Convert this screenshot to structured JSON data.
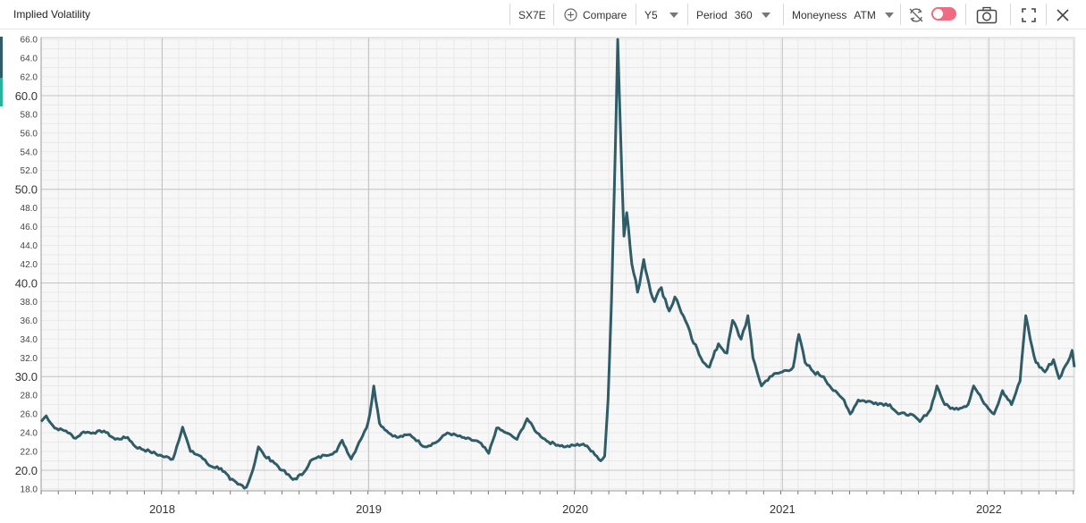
{
  "toolbar": {
    "title": "Implied Volatility",
    "ticker": "SX7E",
    "compare_label": "Compare",
    "tenor": "Y5",
    "period_label": "Period",
    "period_value": "360",
    "moneyness_label": "Moneyness",
    "moneyness_value": "ATM",
    "toggle_state": "off"
  },
  "colors": {
    "series": "#2f5c66",
    "toggle": "#f06a82",
    "accent_left": "#27b39a"
  },
  "chart_data": {
    "type": "line",
    "title": "",
    "xlabel": "",
    "ylabel": "",
    "ylim": [
      17.8,
      66.2
    ],
    "xlim": [
      "2017-06-01",
      "2022-06-01"
    ],
    "grid": true,
    "y_major_ticks": [
      "20.0",
      "30.0",
      "40.0",
      "50.0",
      "60.0"
    ],
    "y_minor_ticks": [
      "18.0",
      "22.0",
      "24.0",
      "26.0",
      "28.0",
      "32.0",
      "34.0",
      "36.0",
      "38.0",
      "42.0",
      "44.0",
      "46.0",
      "48.0",
      "52.0",
      "54.0",
      "56.0",
      "58.0",
      "62.0",
      "64.0",
      "66.0"
    ],
    "x_ticks": [
      "2018",
      "2019",
      "2020",
      "2021",
      "2022"
    ],
    "series": [
      {
        "color": "#2f5c66",
        "points": [
          [
            "2017-06-01",
            25.2
          ],
          [
            "2017-06-10",
            25.8
          ],
          [
            "2017-06-25",
            24.5
          ],
          [
            "2017-07-15",
            24.2
          ],
          [
            "2017-08-01",
            23.4
          ],
          [
            "2017-08-15",
            24.1
          ],
          [
            "2017-09-01",
            24.0
          ],
          [
            "2017-09-20",
            24.2
          ],
          [
            "2017-10-10",
            23.3
          ],
          [
            "2017-11-01",
            23.5
          ],
          [
            "2017-11-15",
            22.5
          ],
          [
            "2017-12-10",
            22.0
          ],
          [
            "2018-01-01",
            21.5
          ],
          [
            "2018-01-20",
            21.2
          ],
          [
            "2018-02-06",
            24.6
          ],
          [
            "2018-02-20",
            22.0
          ],
          [
            "2018-03-10",
            21.5
          ],
          [
            "2018-03-25",
            20.5
          ],
          [
            "2018-04-15",
            20.2
          ],
          [
            "2018-05-01",
            19.0
          ],
          [
            "2018-05-15",
            18.5
          ],
          [
            "2018-05-30",
            18.2
          ],
          [
            "2018-06-10",
            20.0
          ],
          [
            "2018-06-20",
            22.5
          ],
          [
            "2018-07-01",
            21.5
          ],
          [
            "2018-07-15",
            21.0
          ],
          [
            "2018-08-01",
            20.0
          ],
          [
            "2018-08-20",
            19.0
          ],
          [
            "2018-09-05",
            19.5
          ],
          [
            "2018-09-20",
            21.0
          ],
          [
            "2018-10-15",
            21.6
          ],
          [
            "2018-11-05",
            22.0
          ],
          [
            "2018-11-15",
            23.2
          ],
          [
            "2018-12-01",
            21.2
          ],
          [
            "2018-12-15",
            23.0
          ],
          [
            "2018-12-28",
            24.5
          ],
          [
            "2019-01-03",
            26.0
          ],
          [
            "2019-01-10",
            29.0
          ],
          [
            "2019-01-20",
            25.0
          ],
          [
            "2019-02-05",
            24.0
          ],
          [
            "2019-02-20",
            23.5
          ],
          [
            "2019-03-15",
            23.8
          ],
          [
            "2019-04-10",
            22.5
          ],
          [
            "2019-05-01",
            23.0
          ],
          [
            "2019-05-20",
            24.0
          ],
          [
            "2019-06-15",
            23.5
          ],
          [
            "2019-07-15",
            23.0
          ],
          [
            "2019-08-01",
            21.8
          ],
          [
            "2019-08-15",
            24.5
          ],
          [
            "2019-09-01",
            24.0
          ],
          [
            "2019-09-20",
            23.3
          ],
          [
            "2019-10-08",
            25.5
          ],
          [
            "2019-10-25",
            24.0
          ],
          [
            "2019-11-15",
            23.0
          ],
          [
            "2019-12-15",
            22.5
          ],
          [
            "2020-01-15",
            22.8
          ],
          [
            "2020-02-01",
            22.0
          ],
          [
            "2020-02-15",
            21.0
          ],
          [
            "2020-02-22",
            21.5
          ],
          [
            "2020-02-28",
            27.5
          ],
          [
            "2020-03-05",
            38.0
          ],
          [
            "2020-03-10",
            50.0
          ],
          [
            "2020-03-16",
            66.0
          ],
          [
            "2020-03-20",
            58.0
          ],
          [
            "2020-03-27",
            45.0
          ],
          [
            "2020-04-01",
            47.5
          ],
          [
            "2020-04-10",
            42.0
          ],
          [
            "2020-04-20",
            39.0
          ],
          [
            "2020-05-01",
            42.5
          ],
          [
            "2020-05-10",
            40.0
          ],
          [
            "2020-05-20",
            38.0
          ],
          [
            "2020-06-01",
            39.5
          ],
          [
            "2020-06-15",
            37.0
          ],
          [
            "2020-06-25",
            38.5
          ],
          [
            "2020-07-10",
            36.5
          ],
          [
            "2020-07-25",
            34.0
          ],
          [
            "2020-08-10",
            32.0
          ],
          [
            "2020-08-25",
            31.0
          ],
          [
            "2020-09-10",
            33.5
          ],
          [
            "2020-09-25",
            32.5
          ],
          [
            "2020-10-05",
            36.0
          ],
          [
            "2020-10-20",
            34.0
          ],
          [
            "2020-11-01",
            36.5
          ],
          [
            "2020-11-10",
            32.0
          ],
          [
            "2020-11-25",
            29.0
          ],
          [
            "2020-12-10",
            30.0
          ],
          [
            "2021-01-01",
            30.5
          ],
          [
            "2021-01-20",
            31.0
          ],
          [
            "2021-01-30",
            34.5
          ],
          [
            "2021-02-10",
            31.5
          ],
          [
            "2021-02-25",
            30.5
          ],
          [
            "2021-03-15",
            30.0
          ],
          [
            "2021-04-01",
            28.5
          ],
          [
            "2021-04-20",
            27.5
          ],
          [
            "2021-05-01",
            26.0
          ],
          [
            "2021-05-15",
            27.5
          ],
          [
            "2021-06-15",
            27.2
          ],
          [
            "2021-07-10",
            27.0
          ],
          [
            "2021-07-25",
            26.0
          ],
          [
            "2021-08-15",
            26.0
          ],
          [
            "2021-09-01",
            25.2
          ],
          [
            "2021-09-20",
            26.5
          ],
          [
            "2021-10-01",
            29.0
          ],
          [
            "2021-10-15",
            27.0
          ],
          [
            "2021-11-01",
            26.5
          ],
          [
            "2021-11-25",
            27.0
          ],
          [
            "2021-12-05",
            29.0
          ],
          [
            "2021-12-20",
            27.5
          ],
          [
            "2022-01-10",
            26.0
          ],
          [
            "2022-01-25",
            28.5
          ],
          [
            "2022-02-10",
            27.0
          ],
          [
            "2022-02-25",
            29.5
          ],
          [
            "2022-03-07",
            36.5
          ],
          [
            "2022-03-15",
            34.0
          ],
          [
            "2022-03-25",
            31.5
          ],
          [
            "2022-04-10",
            30.5
          ],
          [
            "2022-04-25",
            31.8
          ],
          [
            "2022-05-05",
            29.8
          ],
          [
            "2022-05-20",
            31.5
          ],
          [
            "2022-05-28",
            32.8
          ],
          [
            "2022-06-01",
            31.0
          ]
        ]
      }
    ]
  }
}
